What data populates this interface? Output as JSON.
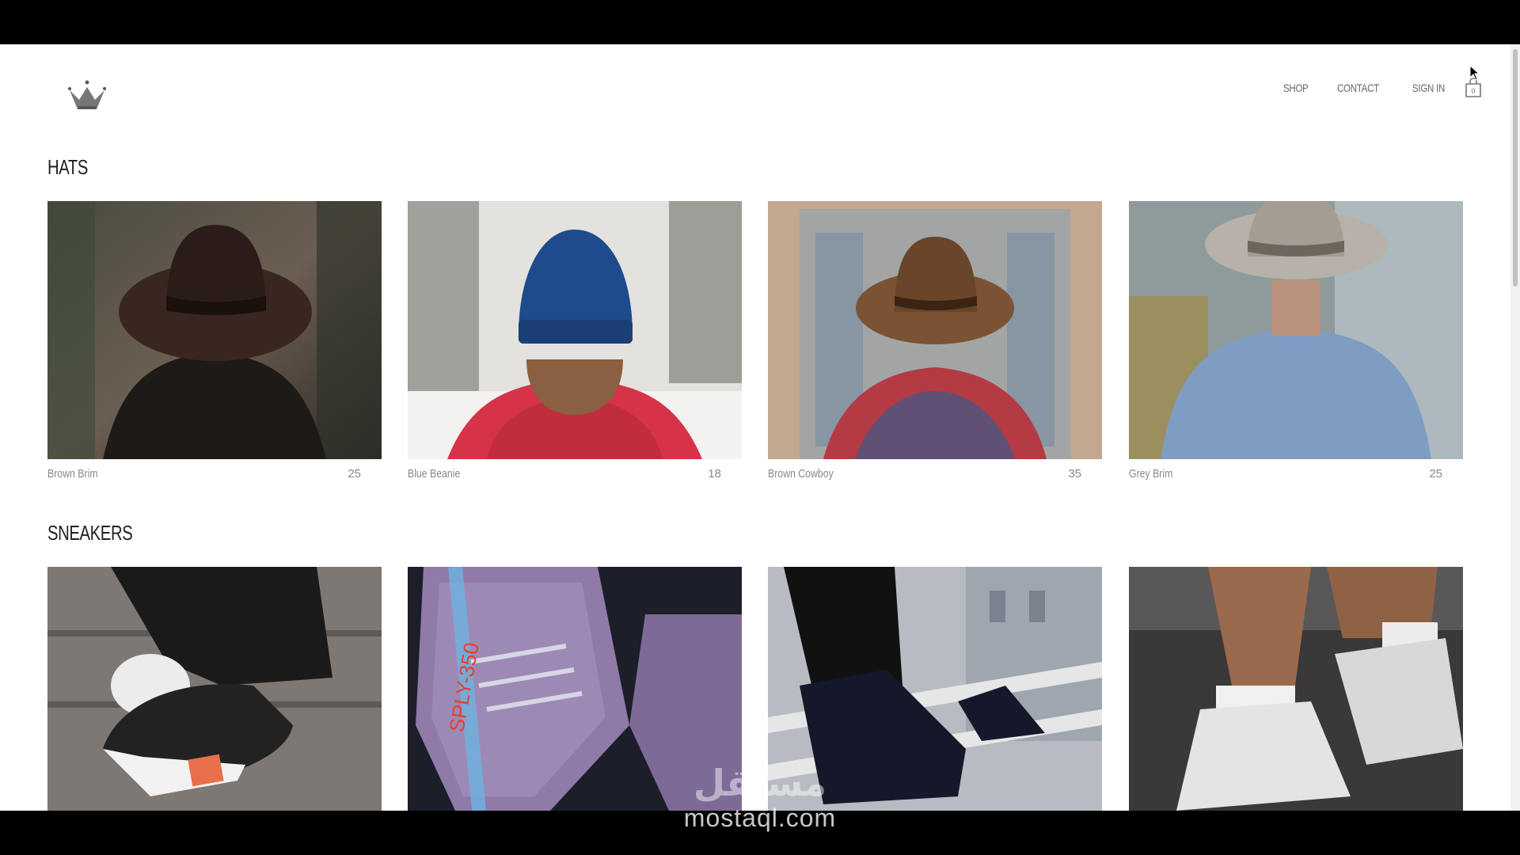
{
  "nav": {
    "items": [
      {
        "label": "SHOP"
      },
      {
        "label": "CONTACT"
      },
      {
        "label": "SIGN IN"
      }
    ],
    "cart_icon": "shopping-bag-icon",
    "logo_icon": "crown-icon"
  },
  "sections": [
    {
      "title": "HATS",
      "items": [
        {
          "name": "Brown Brim",
          "price": "25"
        },
        {
          "name": "Blue Beanie",
          "price": "18"
        },
        {
          "name": "Brown Cowboy",
          "price": "35"
        },
        {
          "name": "Grey Brim",
          "price": "25"
        }
      ]
    },
    {
      "title": "SNEAKERS",
      "items": [
        {
          "name": "",
          "price": ""
        },
        {
          "name": "",
          "price": ""
        },
        {
          "name": "",
          "price": ""
        },
        {
          "name": "",
          "price": ""
        }
      ]
    }
  ],
  "watermark": {
    "arabic": "مستقل",
    "latin": "mostaql.com"
  }
}
